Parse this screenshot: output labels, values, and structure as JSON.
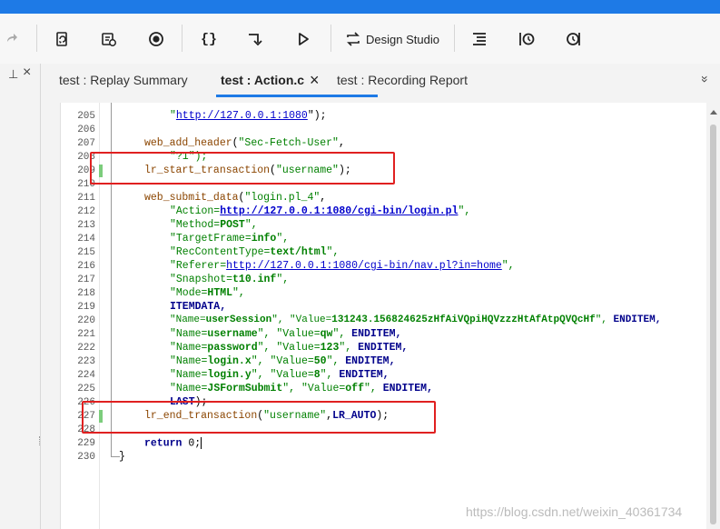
{
  "toolbar": {
    "design_studio_label": "Design Studio"
  },
  "tabs": [
    {
      "label": "test : Replay Summary"
    },
    {
      "label": "test : Action.c"
    },
    {
      "label": "test : Recording Report"
    }
  ],
  "tab_close": "×",
  "overflow_icon": "»",
  "left_panel": {
    "pin": "⊥",
    "close": "×"
  },
  "editor": {
    "line_numbers": [
      "205",
      "206",
      "207",
      "208",
      "209",
      "210",
      "211",
      "212",
      "213",
      "214",
      "215",
      "216",
      "217",
      "218",
      "219",
      "220",
      "221",
      "222",
      "223",
      "224",
      "225",
      "226",
      "227",
      "228",
      "229",
      "230"
    ]
  },
  "code_lines": {
    "l205a": "\"",
    "l205link": "http://127.0.0.1:1080",
    "l205b": "\");",
    "l207fn": "web_add_header",
    "l207a": "(",
    "l207str": "\"Sec-Fetch-User\"",
    "l207b": ",",
    "l208": "\"?1\");",
    "l209fn": "lr_start_transaction",
    "l209a": "(",
    "l209str": "\"username\"",
    "l209b": ");",
    "l211fn": "web_submit_data",
    "l211a": "(",
    "l211str": "\"login.pl_4\"",
    "l211b": ",",
    "l212a": "\"Action=",
    "l212link": "http://127.0.0.1:1080/cgi-bin/login.pl",
    "l212b": "\",",
    "l213a": "\"Method=",
    "l213v": "POST",
    "l213b": "\",",
    "l214a": "\"TargetFrame=",
    "l214v": "info",
    "l214b": "\",",
    "l215a": "\"RecContentType=",
    "l215v": "text/html",
    "l215b": "\",",
    "l216a": "\"Referer=",
    "l216link": "http://127.0.0.1:1080/cgi-bin/nav.pl?in=home",
    "l216b": "\",",
    "l217a": "\"Snapshot=",
    "l217v": "t10.inf",
    "l217b": "\",",
    "l218a": "\"Mode=",
    "l218v": "HTML",
    "l218b": "\",",
    "l219": "ITEMDATA,",
    "l220a": "\"Name=",
    "l220v": "userSession",
    "l220b": "\", \"Value=",
    "l220v2": "131243.156824625zHfAiVQpiHQVzzzHtAfAtpQVQcHf",
    "l220c": "\",",
    "l220k": " ENDITEM,",
    "l221a": "\"Name=",
    "l221v": "username",
    "l221b": "\", \"Value=",
    "l221v2": "qw",
    "l221c": "\",",
    "l221k": " ENDITEM,",
    "l222a": "\"Name=",
    "l222v": "password",
    "l222b": "\", \"Value=",
    "l222v2": "123",
    "l222c": "\",",
    "l222k": " ENDITEM,",
    "l223a": "\"Name=",
    "l223v": "login.x",
    "l223b": "\", \"Value=",
    "l223v2": "50",
    "l223c": "\",",
    "l223k": " ENDITEM,",
    "l224a": "\"Name=",
    "l224v": "login.y",
    "l224b": "\", \"Value=",
    "l224v2": "8",
    "l224c": "\",",
    "l224k": " ENDITEM,",
    "l225a": "\"Name=",
    "l225v": "JSFormSubmit",
    "l225b": "\", \"Value=",
    "l225v2": "off",
    "l225c": "\",",
    "l225k": " ENDITEM,",
    "l226k": "LAST",
    "l226b": ");",
    "l227fn": "lr_end_transaction",
    "l227a": "(",
    "l227str": "\"username\"",
    "l227b": ",",
    "l227k": "LR_AUTO",
    "l227c": ");",
    "l229k": "return",
    "l229b": " 0;",
    "l230": "}"
  },
  "watermark": "https://blog.csdn.net/weixin_40361734",
  "colors": {
    "accent": "#1e7ae6",
    "highlight_box": "#e02020",
    "string": "#008000",
    "keyword": "#00008b",
    "function": "#8b4500"
  }
}
